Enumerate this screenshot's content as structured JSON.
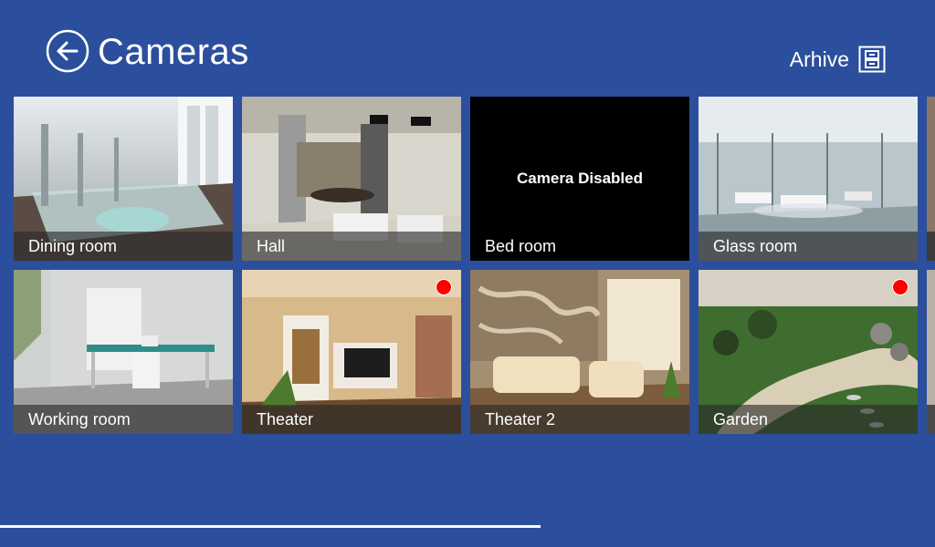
{
  "header": {
    "title": "Cameras",
    "archive_label": "Arhive",
    "back_icon": "arrow-left-icon",
    "archive_icon": "archive-cabinet-icon"
  },
  "cameras": [
    {
      "name": "Dining room",
      "status": "",
      "recording": false
    },
    {
      "name": "Hall",
      "status": "",
      "recording": false
    },
    {
      "name": "Bed room",
      "status": "Camera Disabled",
      "recording": false
    },
    {
      "name": "Glass room",
      "status": "",
      "recording": false
    },
    {
      "name": "Working room",
      "status": "",
      "recording": false
    },
    {
      "name": "Theater",
      "status": "",
      "recording": true
    },
    {
      "name": "Theater 2",
      "status": "",
      "recording": false
    },
    {
      "name": "Garden",
      "status": "",
      "recording": true
    }
  ],
  "colors": {
    "background": "#2b4f9c",
    "recording_indicator": "#ff0000",
    "disabled_tile": "#000000"
  }
}
